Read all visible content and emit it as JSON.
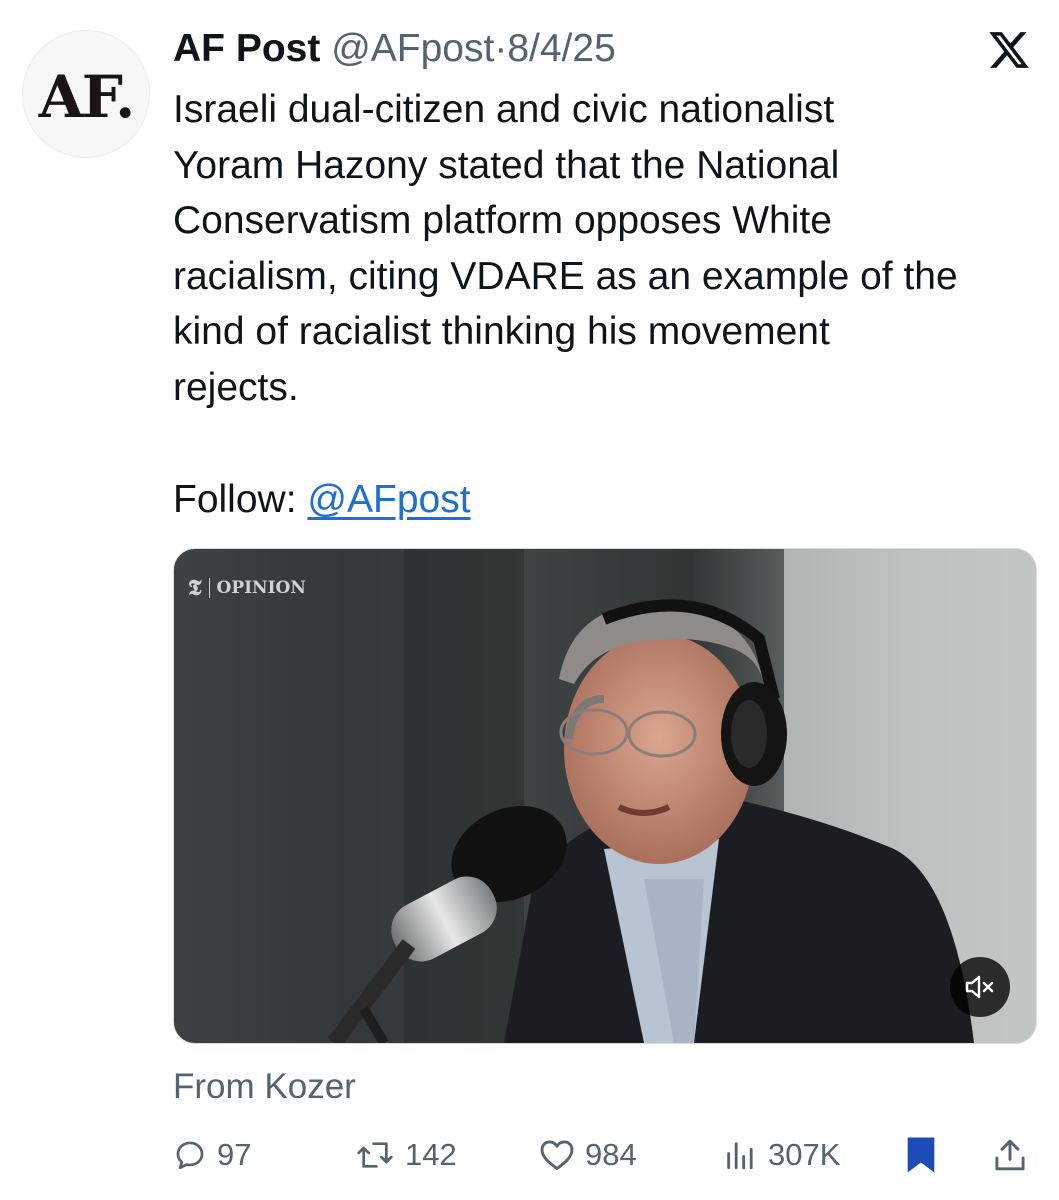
{
  "tweet": {
    "author_name": "AF Post",
    "handle": "@AFpost",
    "separator": "·",
    "date": "8/4/25",
    "avatar_text": "AF.",
    "text_lines": [
      "Israeli dual-citizen and civic nationalist",
      "Yoram Hazony stated that the National",
      "Conservatism platform opposes White",
      "racialism, citing VDARE as an example of the",
      "kind of racialist thinking his movement",
      "rejects."
    ],
    "follow_label": "Follow:",
    "follow_link": "@AFpost"
  },
  "media": {
    "watermark_logo": "𝕿",
    "watermark_text": "OPINION",
    "mute_icon": "volume-muted-icon"
  },
  "source": "From Kozer",
  "actions": {
    "replies": "97",
    "reposts": "142",
    "likes": "984",
    "views": "307K"
  },
  "colors": {
    "text": "#0f1419",
    "secondary": "#536471",
    "link": "#1d6fd1",
    "bookmark_active": "#1d4bb8"
  }
}
